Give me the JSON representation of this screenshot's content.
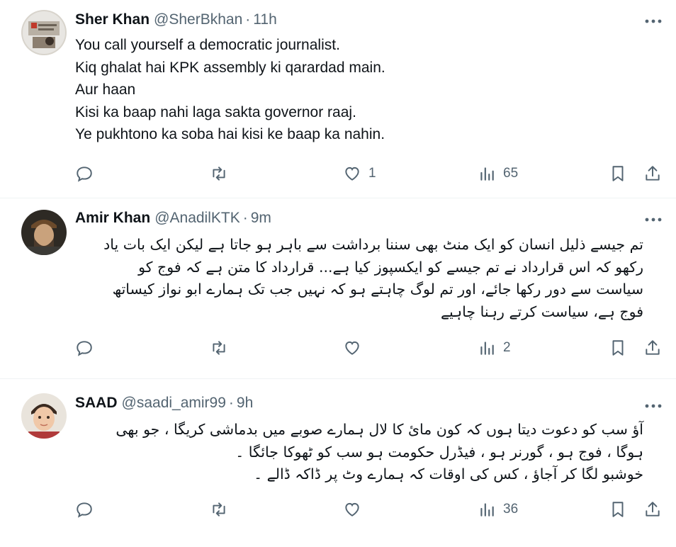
{
  "tweets": [
    {
      "name": "Sher Khan",
      "handle": "@SherBkhan",
      "time": "11h",
      "direction": "ltr",
      "lines": [
        "You call yourself a democratic journalist.",
        "Kiq ghalat hai KPK assembly ki qarardad main.",
        "Aur haan",
        "Kisi ka baap nahi laga sakta governor raaj.",
        "Ye pukhtono ka soba hai kisi ke baap ka nahin."
      ],
      "likes": "1",
      "views": "65"
    },
    {
      "name": "Amir Khan",
      "handle": "@AnadilKTK",
      "time": "9m",
      "direction": "rtl",
      "lines": [
        "تم جیسے ذلیل انسان کو ایک منٹ بھی سننا برداشت سے باہر ہو جاتا ہے لیکن ایک بات یاد",
        "رکھو کہ اس قرارداد نے تم جیسے کو ایکسپوز کیا ہے... قرارداد کا متن ہے کہ فوج کو",
        "سیاست سے دور رکھا جائے، اور تم لوگ چاہتے ہو کہ نہیں جب تک ہمارے ابو نواز کیساتھ",
        "فوج ہے، سیاست کرتے رہنا چاہیے"
      ],
      "likes": "",
      "views": "2"
    },
    {
      "name": "SAAD",
      "handle": "@saadi_amir99",
      "time": "9h",
      "direction": "rtl",
      "lines": [
        "آؤ سب کو دعوت دیتا ہوں کہ کون مائ کا لال ہمارے صوبے میں بدماشی کریگا ، جو بھی",
        "ہوگا ، فوج ہو ، گورنر ہو ، فیڈرل حکومت ہو سب کو ٹھوکا جائگا ۔",
        "خوشبو لگا کر آجاؤ ، کس کی اوقات کہ ہمارے وٹ پر ڈاکہ ڈالے ۔"
      ],
      "likes": "",
      "views": "36"
    }
  ],
  "icons": {
    "reply": "reply-icon",
    "retweet": "retweet-icon",
    "like": "heart-icon",
    "views": "views-icon",
    "bookmark": "bookmark-icon",
    "share": "share-icon",
    "more": "more-icon"
  },
  "colors": {
    "text": "#0f1419",
    "secondary": "#536471",
    "divider": "#eff3f4"
  }
}
